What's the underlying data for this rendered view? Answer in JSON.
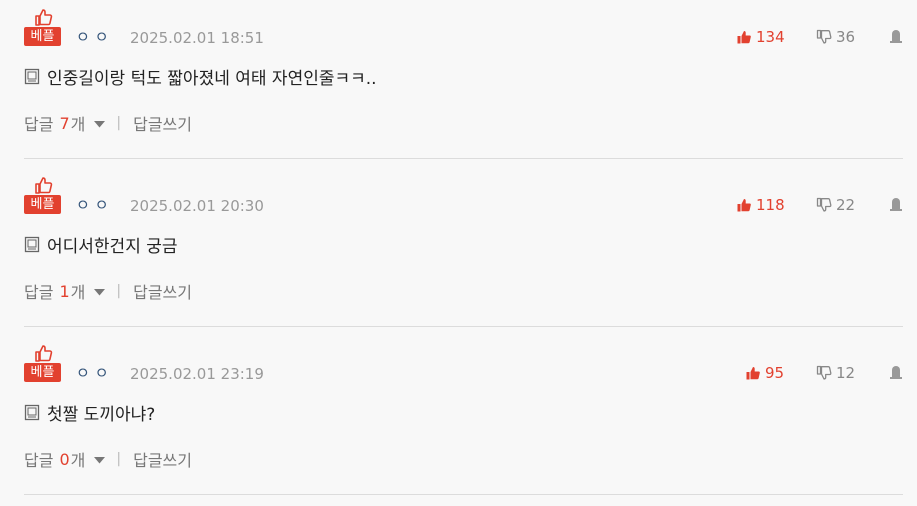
{
  "badge_label": "베플",
  "reply_label": "답글",
  "reply_unit": "개",
  "write_reply_label": "답글쓰기",
  "separator": "|",
  "colors": {
    "accent": "#e2412f",
    "nickname": "#35557a",
    "muted": "#999999"
  },
  "comments": [
    {
      "nickname": "ㅇㅇ",
      "timestamp": "2025.02.01 18:51",
      "upvotes": "134",
      "downvotes": "36",
      "text": "인중길이랑 턱도 짧아졌네 여태 자연인줄ㅋㅋ..",
      "reply_count": "7"
    },
    {
      "nickname": "ㅇㅇ",
      "timestamp": "2025.02.01 20:30",
      "upvotes": "118",
      "downvotes": "22",
      "text": "어디서한건지 궁금",
      "reply_count": "1"
    },
    {
      "nickname": "ㅇㅇ",
      "timestamp": "2025.02.01 23:19",
      "upvotes": "95",
      "downvotes": "12",
      "text": "첫짤 도끼아냐?",
      "reply_count": "0"
    }
  ]
}
